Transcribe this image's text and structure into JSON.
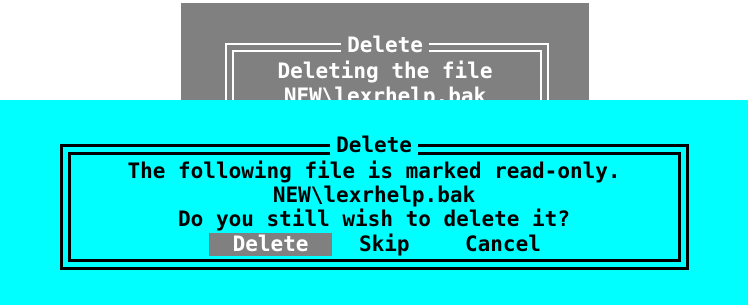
{
  "background_dialog": {
    "title": "Delete",
    "lines": [
      "Deleting the file",
      "NEW\\lexrhelp.bak"
    ]
  },
  "dialog": {
    "title": "Delete",
    "message_line_1": "The following file is marked read-only.",
    "file_name": "NEW\\lexrhelp.bak",
    "question": "Do you still wish to delete it?",
    "buttons": {
      "delete": "Delete",
      "skip": "Skip",
      "cancel": "Cancel"
    }
  },
  "colors": {
    "dialog_background": "#00ffff",
    "background_dialog": "#808080",
    "selected_button": "#808080"
  }
}
